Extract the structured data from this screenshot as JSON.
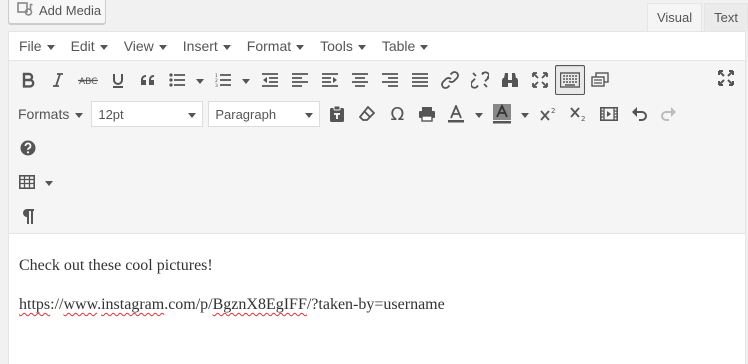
{
  "toolbar_top": {
    "add_media_label": "Add Media",
    "tabs": [
      {
        "label": "Visual",
        "active": true
      },
      {
        "label": "Text",
        "active": false
      }
    ]
  },
  "menubar": {
    "items": [
      {
        "label": "File"
      },
      {
        "label": "Edit"
      },
      {
        "label": "View"
      },
      {
        "label": "Insert"
      },
      {
        "label": "Format"
      },
      {
        "label": "Tools"
      },
      {
        "label": "Table"
      }
    ]
  },
  "formatting": {
    "formats_label": "Formats",
    "font_size": "12pt",
    "block_format": "Paragraph"
  },
  "content": {
    "line1": "Check out these cool pictures!",
    "url_parts": [
      "https",
      "://",
      "www",
      ".",
      "instagram",
      ".com/p/",
      "BgznX8EgIFF",
      "/?taken-by=username"
    ]
  },
  "colors": {
    "icon": "#555555",
    "spellcheck_underline": "#d63638",
    "toolbar_bg": "#f5f5f5",
    "page_bg": "#f1f1f1"
  }
}
